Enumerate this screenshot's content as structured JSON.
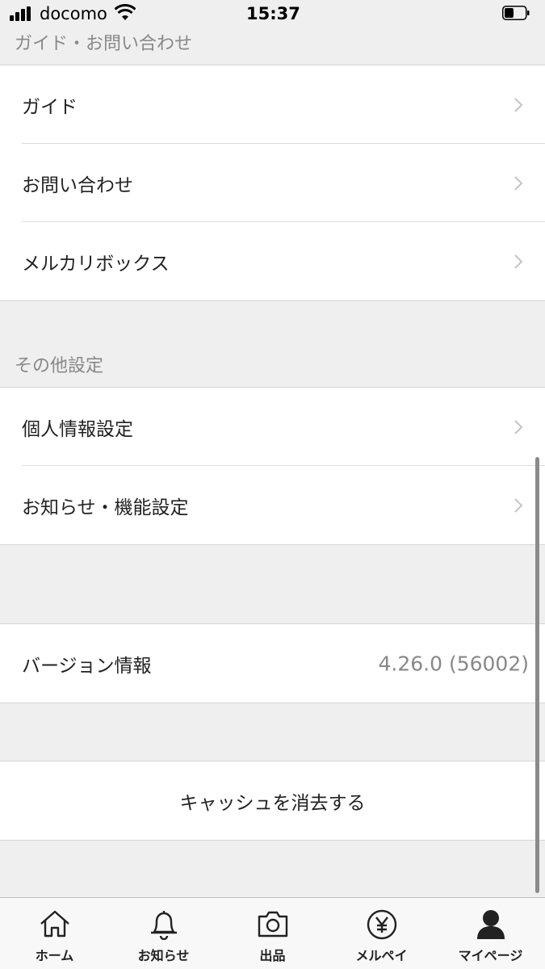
{
  "status_bar": {
    "carrier": "docomo",
    "time": "15:37",
    "battery_level": 0.45
  },
  "sections": {
    "guide": {
      "header": "ガイド・お問い合わせ",
      "items": [
        {
          "label": "ガイド"
        },
        {
          "label": "お問い合わせ"
        },
        {
          "label": "メルカリボックス"
        }
      ]
    },
    "other": {
      "header": "その他設定",
      "items": [
        {
          "label": "個人情報設定"
        },
        {
          "label": "お知らせ・機能設定"
        }
      ]
    }
  },
  "version": {
    "label": "バージョン情報",
    "value": "4.26.0 (56002)"
  },
  "cache": {
    "label": "キャッシュを消去する"
  },
  "tabs": [
    {
      "label": "ホーム",
      "icon": "home-icon"
    },
    {
      "label": "お知らせ",
      "icon": "bell-icon"
    },
    {
      "label": "出品",
      "icon": "camera-icon"
    },
    {
      "label": "メルペイ",
      "icon": "yen-icon"
    },
    {
      "label": "マイページ",
      "icon": "person-icon"
    }
  ]
}
